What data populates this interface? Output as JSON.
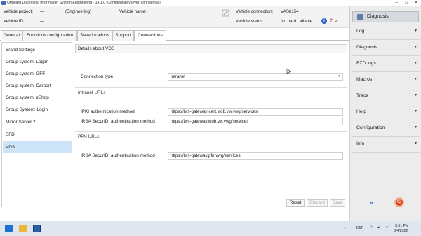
{
  "window": {
    "title": "Offboard Diagnostic Information System Engineering - 14.1.0 (Confidentiality level: confidential)"
  },
  "vehicle": {
    "project_label": "Vehicle project:",
    "project_value": "—",
    "mode_value": "(Engineering)",
    "name_label": "Vehicle name:",
    "id_label": "Vehicle ID:",
    "id_value": "—",
    "connection_label": "Vehicle connection:",
    "connection_value": "VAS6154",
    "status_label": "Vehicle status:",
    "status_value": "No hard...ailable"
  },
  "tabs": [
    {
      "label": "General"
    },
    {
      "label": "Functions configuration"
    },
    {
      "label": "Save locations"
    },
    {
      "label": "Support"
    },
    {
      "label": "Connections"
    }
  ],
  "nav": {
    "items": [
      {
        "label": "Brand Settings"
      },
      {
        "label": "Group system: Logon"
      },
      {
        "label": "Group system: GFF"
      },
      {
        "label": "Group system: Carport"
      },
      {
        "label": "Group system: eShop"
      },
      {
        "label": "Group System: Login"
      },
      {
        "label": "Mirror Server 2"
      },
      {
        "label": "SFD"
      },
      {
        "label": "VDS"
      }
    ]
  },
  "vds": {
    "header": "Details about VDS",
    "connection_type_label": "Connection type",
    "connection_type_value": "Intranet",
    "intranet_section": "Intranet URLs",
    "pki_label": "IPKI authentication method",
    "pki_value": "https://lws-gateway-cert.wob.vw.vwg/services",
    "securid_label": "IRSA SecurIDI authentication method",
    "securid_value": "https://lws-gateway.wob.vw.vwg/services",
    "pfn_section": "PFN URLs",
    "pfn_label": "IRSA SecurIDI authentication method",
    "pfn_value": "https://lws-gateway.pfn.vwg/services"
  },
  "footer": {
    "reset": "Reset",
    "discard": "Discard",
    "save": "Save"
  },
  "side": {
    "diagnosis": "Diagnosis",
    "sections": [
      {
        "label": "Log"
      },
      {
        "label": "Diagnosis"
      },
      {
        "label": "BZD logs"
      },
      {
        "label": "Macros"
      },
      {
        "label": "Trace"
      },
      {
        "label": "Help"
      },
      {
        "label": "Configuration"
      },
      {
        "label": "Info"
      }
    ]
  },
  "taskbar": {
    "language": "ESP",
    "time": "3:51 PM",
    "date": "8/4/2022"
  },
  "colors": {
    "selected_nav": "#cde3f7",
    "forward_button": "#2f63c7",
    "exit_button": "#e04a1c"
  }
}
